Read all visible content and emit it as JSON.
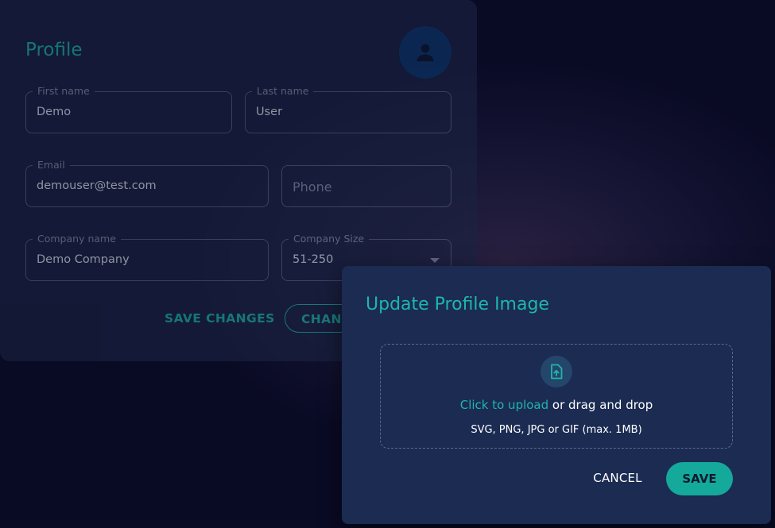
{
  "profile": {
    "title": "Profile",
    "avatar_icon": "person-icon",
    "fields": {
      "first_name": {
        "label": "First name",
        "value": "Demo"
      },
      "last_name": {
        "label": "Last name",
        "value": "User"
      },
      "email": {
        "label": "Email",
        "value": "demouser@test.com"
      },
      "phone": {
        "placeholder": "Phone"
      },
      "company_name": {
        "label": "Company name",
        "value": "Demo Company"
      },
      "company_size": {
        "label": "Company Size",
        "value": "51-250"
      }
    },
    "save_changes_label": "SAVE CHANGES",
    "change_button_label": "CHANG"
  },
  "modal": {
    "title": "Update Profile Image",
    "upload_icon": "file-upload-icon",
    "upload_link": "Click to upload",
    "upload_text": " or drag and drop",
    "upload_hint": "SVG, PNG, JPG or GIF (max. 1MB)",
    "cancel_label": "CANCEL",
    "save_label": "SAVE"
  },
  "colors": {
    "accent": "#1fb6aa",
    "save_button": "#14a99b",
    "modal_bg": "#1b2b52",
    "card_bg": "#1a2341",
    "page_bg": "#090a24"
  }
}
